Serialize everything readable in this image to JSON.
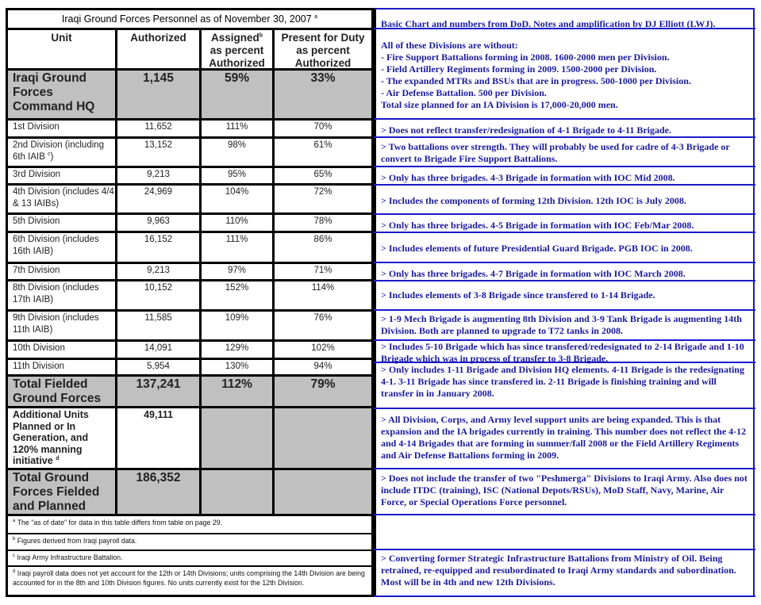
{
  "table": {
    "title": "Iraqi Ground Forces Personnel as of November 30, 2007",
    "title_sup": "a",
    "headers": {
      "unit": "Unit",
      "authorized": "Authorized",
      "assigned": "Assigned",
      "assigned_sup": "b",
      "assigned_line2": "as percent",
      "assigned_line3": "Authorized",
      "present": "Present for Duty",
      "present_line2": "as percent",
      "present_line3": "Authorized"
    },
    "rows": [
      {
        "unit": "Iraqi Ground Forces Command HQ",
        "authorized": "1,145",
        "assigned": "59%",
        "present": "33%"
      },
      {
        "unit": "1st Division",
        "authorized": "11,652",
        "assigned": "111%",
        "present": "70%"
      },
      {
        "unit": "2nd Division (including 6th IAIB",
        "unit_sup": "c",
        "unit_tail": ")",
        "authorized": "13,152",
        "assigned": "98%",
        "present": "61%"
      },
      {
        "unit": "3rd Division",
        "authorized": "9,213",
        "assigned": "95%",
        "present": "65%"
      },
      {
        "unit": "4th Division (includes 4/4 & 13 IAIBs)",
        "authorized": "24,969",
        "assigned": "104%",
        "present": "72%"
      },
      {
        "unit": "5th Division",
        "authorized": "9,963",
        "assigned": "110%",
        "present": "78%"
      },
      {
        "unit": "6th Division (includes 16th IAIB)",
        "authorized": "16,152",
        "assigned": "111%",
        "present": "86%"
      },
      {
        "unit": "7th Division",
        "authorized": "9,213",
        "assigned": "97%",
        "present": "71%"
      },
      {
        "unit": "8th Division (includes 17th IAIB)",
        "authorized": "10,152",
        "assigned": "152%",
        "present": "114%"
      },
      {
        "unit": "9th Division (includes 11th IAIB)",
        "authorized": "11,585",
        "assigned": "109%",
        "present": "76%"
      },
      {
        "unit": "10th Division",
        "authorized": "14,091",
        "assigned": "129%",
        "present": "102%"
      },
      {
        "unit": "11th Division",
        "authorized": "5,954",
        "assigned": "130%",
        "present": "94%"
      },
      {
        "unit": "Total Fielded Ground Forces",
        "authorized": "137,241",
        "assigned": "112%",
        "present": "79%"
      },
      {
        "unit": "Additional Units Planned or In Generation, and 120% manning initiative",
        "unit_sup": "d",
        "authorized": "49,111",
        "assigned": "",
        "present": ""
      },
      {
        "unit": "Total Ground Forces Fielded and Planned",
        "authorized": "186,352",
        "assigned": "",
        "present": ""
      }
    ],
    "footnotes": [
      {
        "mark": "a",
        "text": "The \"as of date\" for data in this table differs from table on page 29."
      },
      {
        "mark": "b",
        "text": "Figures derived from Iraqi payroll data."
      },
      {
        "mark": "c",
        "text": "Iraqi Army Infrastructure Battalion."
      },
      {
        "mark": "d",
        "text": "Iraqi payroll data does not yet account for the 12th or 14th Divisions; units comprising the 14th Division are being accounted for in the 8th and 10th Division figures.  No units currently exist for the 12th Division."
      }
    ]
  },
  "notes": {
    "header": "Basic Chart and numbers from DoD.  Notes and amplification by DJ Elliott (LWJ).",
    "intro": {
      "lead": "All of these Divisions are without:",
      "items": [
        "-  Fire Support Battalions forming in 2008.  1600-2000 men per Division.",
        "-  Field Artillery Regiments forming in 2009.  1500-2000 per Division.",
        "-  The expanded MTRs and BSUs that are in progress.  500-1000 per Division.",
        "-  Air Defense Battalion.  500 per Division."
      ],
      "tail": "Total size planned for an IA Division is 17,000-20,000 men."
    },
    "rows": [
      ">  Does not reflect transfer/redesignation of 4-1 Brigade to 4-11 Brigade.",
      ">  Two battalions over strength.  They will probably be used for cadre of 4-3 Brigade or convert to Brigade Fire Support Battalions.",
      ">  Only has three brigades.  4-3 Brigade in formation with IOC Mid 2008.",
      ">  Includes the components of forming 12th Division.  12th IOC is July 2008.",
      ">  Only has three brigades.  4-5 Brigade in formation with IOC Feb/Mar 2008.",
      ">  Includes elements of future Presidential Guard Brigade.  PGB IOC in 2008.",
      ">  Only has three brigades.  4-7 Brigade in formation with IOC March 2008.",
      ">  Includes elements of 3-8 Brigade since transfered to 1-14 Brigade.",
      "> 1-9 Mech Brigade is augmenting 8th Division and 3-9 Tank Brigade is augmenting 14th Division.  Both are planned to upgrade to T72 tanks in 2008.",
      ">  Includes 5-10 Brigade which has since transfered/redesignated to 2-14 Brigade and 1-10 Brigade which was in process of transfer to 3-8 Brigade.",
      ">  Only includes 1-11 Brigade and Division HQ elements.  4-11 Brigade is the redesignating 4-1.  3-11 Brigade has since transfered in.  2-11 Brigade is finishing training and will transfer in in January 2008.",
      ">  All Division, Corps, and Army level support units are being expanded.  This is that expansion and the IA brigades currently in training.  This number does not reflect the 4-12 and 4-14 Brigades that are forming in summer/fall 2008 or the Field Artillery Regiments and Air Defense Battalions forming in 2009.",
      ">  Does not include the transfer of two \"Peshmerga\" Divisions to Iraqi Army.  Also does not include ITDC (training), ISC (National Depots/RSUs), MoD Staff, Navy, Marine, Air Force, or Special Operations Force personnel.",
      "",
      ">  Converting former Strategic Infrastructure Battalions from Ministry of Oil. Being retrained, re-equipped and resubordinated to Iraqi Army standards and subordination.  Most will be in 4th and new 12th Divisions."
    ]
  }
}
